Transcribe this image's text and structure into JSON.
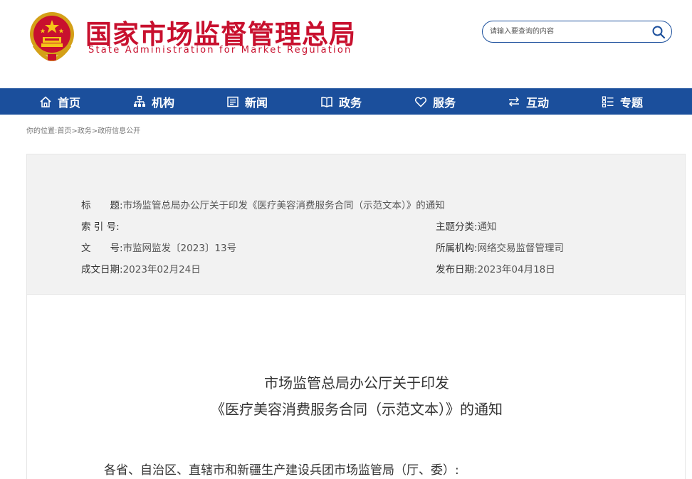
{
  "header": {
    "title": "国家市场监督管理总局",
    "subtitle": "State Administration for Market Regulation",
    "brand_color": "#c8102e"
  },
  "search": {
    "placeholder": "请输入要查询的内容",
    "icon": "search-icon"
  },
  "nav": {
    "color": "#1b4f9c",
    "items": [
      {
        "label": "首页",
        "icon": "home-icon"
      },
      {
        "label": "机构",
        "icon": "org-icon"
      },
      {
        "label": "新闻",
        "icon": "news-icon"
      },
      {
        "label": "政务",
        "icon": "government-icon"
      },
      {
        "label": "服务",
        "icon": "heart-icon"
      },
      {
        "label": "互动",
        "icon": "exchange-icon"
      },
      {
        "label": "专题",
        "icon": "topic-icon"
      }
    ]
  },
  "breadcrumb": "你的位置:首页>政务>政府信息公开",
  "info": {
    "title_label": "标　　题:",
    "title_value": "市场监管总局办公厅关于印发《医疗美容消费服务合同（示范文本）》的通知",
    "index_label": "索 引 号:",
    "index_value": "",
    "category_label": "主题分类:",
    "category_value": "通知",
    "docno_label": "文　　号:",
    "docno_value": "市监网监发〔2023〕13号",
    "org_label": "所属机构:",
    "org_value": "网络交易监督管理司",
    "date_label": "成文日期:",
    "date_value": "2023年02月24日",
    "publish_label": "发布日期:",
    "publish_value": "2023年04月18日"
  },
  "document": {
    "title_line1": "市场监管总局办公厅关于印发",
    "title_line2": "《医疗美容消费服务合同（示范文本）》的通知",
    "greeting": "各省、自治区、直辖市和新疆生产建设兵团市场监管局（厅、委）:"
  }
}
